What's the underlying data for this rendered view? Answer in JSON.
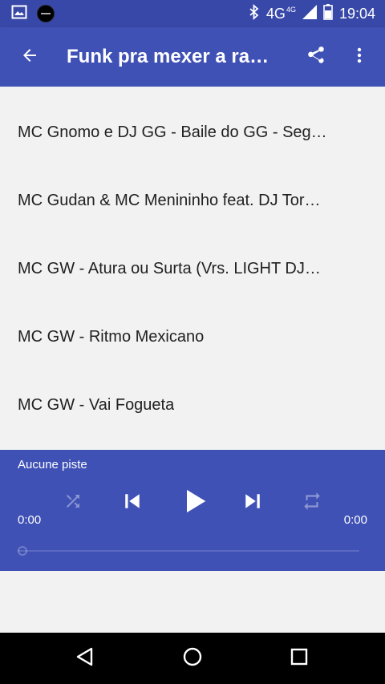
{
  "status_bar": {
    "network": "4G",
    "network_small": "4G",
    "time": "19:04",
    "icons": [
      "image-icon",
      "vinyl-icon",
      "bluetooth-icon",
      "signal-icon",
      "battery-icon"
    ]
  },
  "app_bar": {
    "title": "Funk pra mexer a ra…",
    "icons": [
      "arrow-back-icon",
      "share-icon",
      "more-vert-icon"
    ]
  },
  "tracks": [
    {
      "label": "MC Gnomo e DJ GG - Baile do GG - Seg…"
    },
    {
      "label": "MC Gudan & MC Menininho feat. DJ Tor…"
    },
    {
      "label": "MC GW - Atura ou Surta (Vrs. LIGHT DJ…"
    },
    {
      "label": "MC GW - Ritmo Mexicano"
    },
    {
      "label": "MC GW - Vai Fogueta"
    }
  ],
  "player": {
    "track_name": "Aucune piste",
    "time_elapsed": "0:00",
    "time_total": "0:00",
    "progress": 0,
    "icons": [
      "shuffle-icon",
      "skip-previous-icon",
      "play-icon",
      "skip-next-icon",
      "repeat-icon"
    ]
  },
  "colors": {
    "primary": "#3f51b5",
    "primary_dark": "#3848a8",
    "background": "#f2f2f2",
    "text": "#212121"
  },
  "nav_bar": {
    "icons": [
      "back-triangle-icon",
      "home-circle-icon",
      "recents-square-icon"
    ]
  }
}
